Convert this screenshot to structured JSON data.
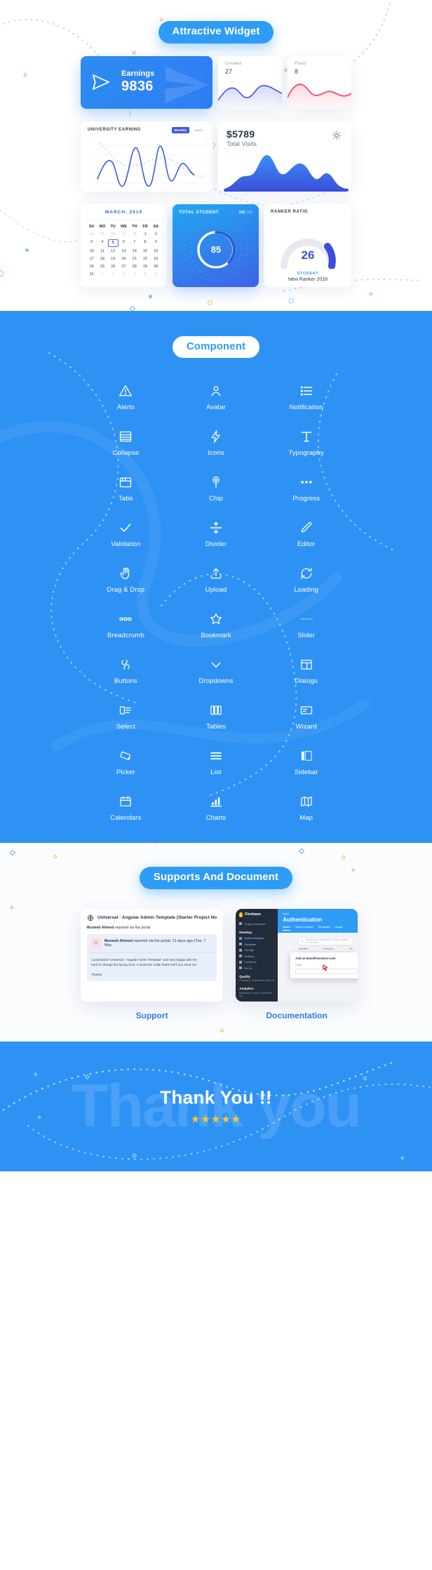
{
  "widgets_section": {
    "heading": "Attractive Widget",
    "earnings_card": {
      "label": "Earnings",
      "value": "9836",
      "icon": "send-icon"
    },
    "mini_cards": [
      {
        "label": "Created",
        "value": "27",
        "color": "#3b4fd8"
      },
      {
        "label": "Fixed",
        "value": "8",
        "color": "#f2556e"
      }
    ],
    "university_card": {
      "title": "UNIVERSITY EARNING",
      "btn_primary": "Monthly",
      "btn_secondary": "yearly"
    },
    "visits_card": {
      "amount": "$5789",
      "label": "Total Visits",
      "icon": "sun-icon"
    },
    "calendar_card": {
      "title": "MARCH, 2019",
      "weekdays": [
        "SU",
        "MO",
        "TU",
        "WE",
        "TH",
        "FR",
        "SA"
      ],
      "weeks": [
        [
          "24",
          "25",
          "26",
          "27",
          "28",
          "1",
          "2"
        ],
        [
          "3",
          "4",
          "5",
          "6",
          "7",
          "8",
          "9"
        ],
        [
          "10",
          "11",
          "12",
          "13",
          "14",
          "15",
          "16"
        ],
        [
          "17",
          "18",
          "19",
          "20",
          "21",
          "22",
          "23"
        ],
        [
          "24",
          "25",
          "26",
          "27",
          "28",
          "29",
          "30"
        ],
        [
          "31",
          "1",
          "2",
          "3",
          "4",
          "5",
          "6"
        ]
      ],
      "selected": "5"
    },
    "student_card": {
      "title": "TOTAL STUDENT",
      "count": "120",
      "total": "/ 150",
      "gauge_value": "85"
    },
    "ranker_card": {
      "title": "RANKER RATIO",
      "value": "26",
      "sub": "STUDENT",
      "caption": "New Ranker 2018"
    }
  },
  "components_section": {
    "heading": "Component",
    "items": [
      {
        "label": "Alerts",
        "icon": "alert-triangle-icon"
      },
      {
        "label": "Avatar",
        "icon": "user-avatar-icon"
      },
      {
        "label": "Notification",
        "icon": "notification-list-icon"
      },
      {
        "label": "Collapse",
        "icon": "collapse-rows-icon"
      },
      {
        "label": "Icons",
        "icon": "bolt-icon"
      },
      {
        "label": "Typography",
        "icon": "typography-t-icon"
      },
      {
        "label": "Tabs",
        "icon": "tabs-window-icon"
      },
      {
        "label": "Chip",
        "icon": "chip-pin-icon"
      },
      {
        "label": "Progress",
        "icon": "progress-dots-icon"
      },
      {
        "label": "Validation",
        "icon": "check-icon"
      },
      {
        "label": "Divider",
        "icon": "divider-arrows-icon"
      },
      {
        "label": "Editor",
        "icon": "pencil-icon"
      },
      {
        "label": "Drag & Drop",
        "icon": "hand-drag-icon"
      },
      {
        "label": "Upload",
        "icon": "upload-icon"
      },
      {
        "label": "Loading",
        "icon": "refresh-loading-icon"
      },
      {
        "label": "Breadcrumb",
        "icon": "breadcrumb-blocks-icon"
      },
      {
        "label": "Bookmark",
        "icon": "star-icon"
      },
      {
        "label": "Slider",
        "icon": "slider-dots-icon"
      },
      {
        "label": "Buttons",
        "icon": "link-chain-icon"
      },
      {
        "label": "Dropdowns",
        "icon": "chevron-down-icon"
      },
      {
        "label": "Dialogs",
        "icon": "dialog-layout-icon"
      },
      {
        "label": "Select",
        "icon": "select-list-icon"
      },
      {
        "label": "Tables",
        "icon": "table-columns-icon"
      },
      {
        "label": "Wizard",
        "icon": "wizard-card-icon"
      },
      {
        "label": "Picker",
        "icon": "color-picker-icon"
      },
      {
        "label": "List",
        "icon": "list-lines-icon"
      },
      {
        "label": "Sidebar",
        "icon": "sidebar-panel-icon"
      },
      {
        "label": "Calendars",
        "icon": "calendar-icon"
      },
      {
        "label": "Charts",
        "icon": "bar-chart-icon"
      },
      {
        "label": "Map",
        "icon": "map-fold-icon"
      }
    ]
  },
  "supports_section": {
    "heading": "Supports And Document",
    "support": {
      "caption": "Support",
      "ticket_title": "Universal - Angular Admin Template (Starter Project No",
      "reporter_line_name": "Muneeb Ahmed",
      "reporter_line_rest": "reported via the portal",
      "comment_name": "Muneeb Ahmed",
      "comment_meta": "reported via the portal. 21 days ago (Tue, 7 May",
      "body_line1": "I purchased \"Universal - Angular Admin Template\" and very happy with the",
      "body_line2": "hard to change but facing error. it would be really thank full if you send me",
      "body_line3": "Thanks.",
      "avatar_initial": "M",
      "icon": "globe-icon"
    },
    "documentation": {
      "caption": "Documentation",
      "brand": "Firebase",
      "breadcrumb": "demo",
      "page_title": "Authentication",
      "tabs": [
        "Users",
        "Sign-in method",
        "Templates",
        "Usage"
      ],
      "search_placeholder": "Search by email address, phone number or user UID",
      "table_headers": [
        "Identifier",
        "Providers",
        "Cre"
      ],
      "nav_top": "Project Overview",
      "nav_groups": [
        {
          "title": "Develop",
          "items": [
            "Authentication",
            "Database",
            "Storage",
            "Hosting",
            "Functions",
            "ML Kit"
          ]
        },
        {
          "title": "Quality",
          "sub": "Crashlytics, Performance, Test Lab",
          "items": []
        },
        {
          "title": "Analytics",
          "sub": "Dashboard, Events, Conversions, Au...",
          "items": []
        }
      ],
      "modal_title": "Add an Email/Password user",
      "modal_label": "Email"
    }
  },
  "footer_section": {
    "ghost_text": "Thank you",
    "title": "Thank You !!",
    "stars": "★★★★★",
    "star_count": 5
  },
  "colors": {
    "brand_blue": "#2e92f5",
    "deep_blue": "#3b4fd8",
    "red": "#f2556e",
    "yellow": "#ffc928",
    "pink": "#fb8e9b"
  }
}
